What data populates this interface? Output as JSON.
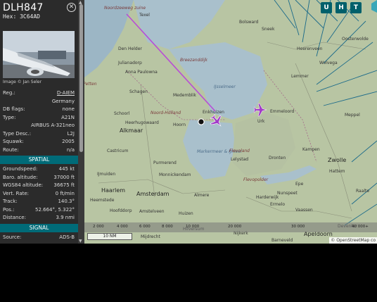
{
  "aircraft": {
    "callsign": "DLH847",
    "hex_label": "Hex:",
    "hex": "3C64AD",
    "photo_credit": "Image © Jan Seler"
  },
  "details": [
    {
      "key": "Reg.:",
      "value": "D-AIEM",
      "link": true
    },
    {
      "key": "",
      "value": "Germany"
    },
    {
      "key": "DB flags:",
      "value": "none"
    },
    {
      "key": "Type:",
      "value": "A21N"
    },
    {
      "key": "",
      "value": "AIRBUS A-321neo"
    },
    {
      "key": "Type Desc.:",
      "value": "L2J"
    },
    {
      "key": "Squawk:",
      "value": "2005"
    },
    {
      "key": "Route:",
      "value": "n/a"
    }
  ],
  "spatial_title": "SPATIAL",
  "spatial": [
    {
      "key": "Groundspeed:",
      "value": "445 kt"
    },
    {
      "key": "Baro. altitude:",
      "value": "37000 ft"
    },
    {
      "key": "WGS84 altitude:",
      "value": "36675 ft"
    },
    {
      "key": "Vert. Rate:",
      "value": "0 ft/min"
    },
    {
      "key": "Track:",
      "value": "140.3°"
    },
    {
      "key": "Pos.:",
      "value": "52.664°, 5.322°"
    },
    {
      "key": "Distance:",
      "value": "3.9 nmi"
    }
  ],
  "signal_title": "SIGNAL",
  "signal": [
    {
      "key": "Source:",
      "value": "ADS-B"
    }
  ],
  "map": {
    "buttons": [
      "U",
      "H",
      "T"
    ],
    "scale_label": "10 NM",
    "attribution": "© OpenStreetMap co",
    "altitude_legend": [
      "2 000",
      "4 000",
      "6 000",
      "8 000",
      "10 000",
      "20 000",
      "30 000",
      "40 000+"
    ],
    "places": [
      {
        "name": "Noordzeeweg zuine",
        "cls": "red"
      },
      {
        "name": "Texel",
        "cls": ""
      },
      {
        "name": "Den Helder",
        "cls": ""
      },
      {
        "name": "Julianadorp",
        "cls": ""
      },
      {
        "name": "Anna Paulowna",
        "cls": ""
      },
      {
        "name": "Breezanddijk",
        "cls": "red"
      },
      {
        "name": "Bolsward",
        "cls": ""
      },
      {
        "name": "Sneek",
        "cls": ""
      },
      {
        "name": "Heerenveen",
        "cls": ""
      },
      {
        "name": "Oosterwolde",
        "cls": ""
      },
      {
        "name": "Wolvega",
        "cls": ""
      },
      {
        "name": "Lemmer",
        "cls": ""
      },
      {
        "name": "IJsselmeer",
        "cls": "water"
      },
      {
        "name": "Schagen",
        "cls": ""
      },
      {
        "name": "Medemblik",
        "cls": ""
      },
      {
        "name": "Petten",
        "cls": "red"
      },
      {
        "name": "Noord-Holland",
        "cls": "red"
      },
      {
        "name": "Enkhuizen",
        "cls": ""
      },
      {
        "name": "Schoorl",
        "cls": ""
      },
      {
        "name": "Heerhugowaard",
        "cls": ""
      },
      {
        "name": "Hoorn",
        "cls": ""
      },
      {
        "name": "Urk",
        "cls": ""
      },
      {
        "name": "Emmeloord",
        "cls": ""
      },
      {
        "name": "Meppel",
        "cls": ""
      },
      {
        "name": "Alkmaar",
        "cls": "big"
      },
      {
        "name": "Castricum",
        "cls": ""
      },
      {
        "name": "Purmerend",
        "cls": ""
      },
      {
        "name": "Markermeer & IJmeer",
        "cls": "water"
      },
      {
        "name": "Flevoland",
        "cls": "red"
      },
      {
        "name": "Lelystad",
        "cls": ""
      },
      {
        "name": "Dronten",
        "cls": ""
      },
      {
        "name": "Kampen",
        "cls": ""
      },
      {
        "name": "Zwolle",
        "cls": "big"
      },
      {
        "name": "Hattem",
        "cls": ""
      },
      {
        "name": "IJmuiden",
        "cls": ""
      },
      {
        "name": "Monnickendam",
        "cls": ""
      },
      {
        "name": "Flevopolder",
        "cls": "red"
      },
      {
        "name": "Haarlem",
        "cls": "big"
      },
      {
        "name": "Amsterdam",
        "cls": "big"
      },
      {
        "name": "Almere",
        "cls": ""
      },
      {
        "name": "Harderwijk",
        "cls": ""
      },
      {
        "name": "Nunspeet",
        "cls": ""
      },
      {
        "name": "Epe",
        "cls": ""
      },
      {
        "name": "Raalte",
        "cls": ""
      },
      {
        "name": "Heemstede",
        "cls": ""
      },
      {
        "name": "Hoofddorp",
        "cls": ""
      },
      {
        "name": "Amstelveen",
        "cls": ""
      },
      {
        "name": "Huizen",
        "cls": ""
      },
      {
        "name": "Ermelo",
        "cls": ""
      },
      {
        "name": "Vaassen",
        "cls": ""
      },
      {
        "name": "Hilversum",
        "cls": ""
      },
      {
        "name": "Nijkerk",
        "cls": ""
      },
      {
        "name": "Apeldoorn",
        "cls": "big"
      },
      {
        "name": "Deventer",
        "cls": ""
      },
      {
        "name": "Mijdrecht",
        "cls": ""
      },
      {
        "name": "Barneveld",
        "cls": ""
      }
    ]
  }
}
